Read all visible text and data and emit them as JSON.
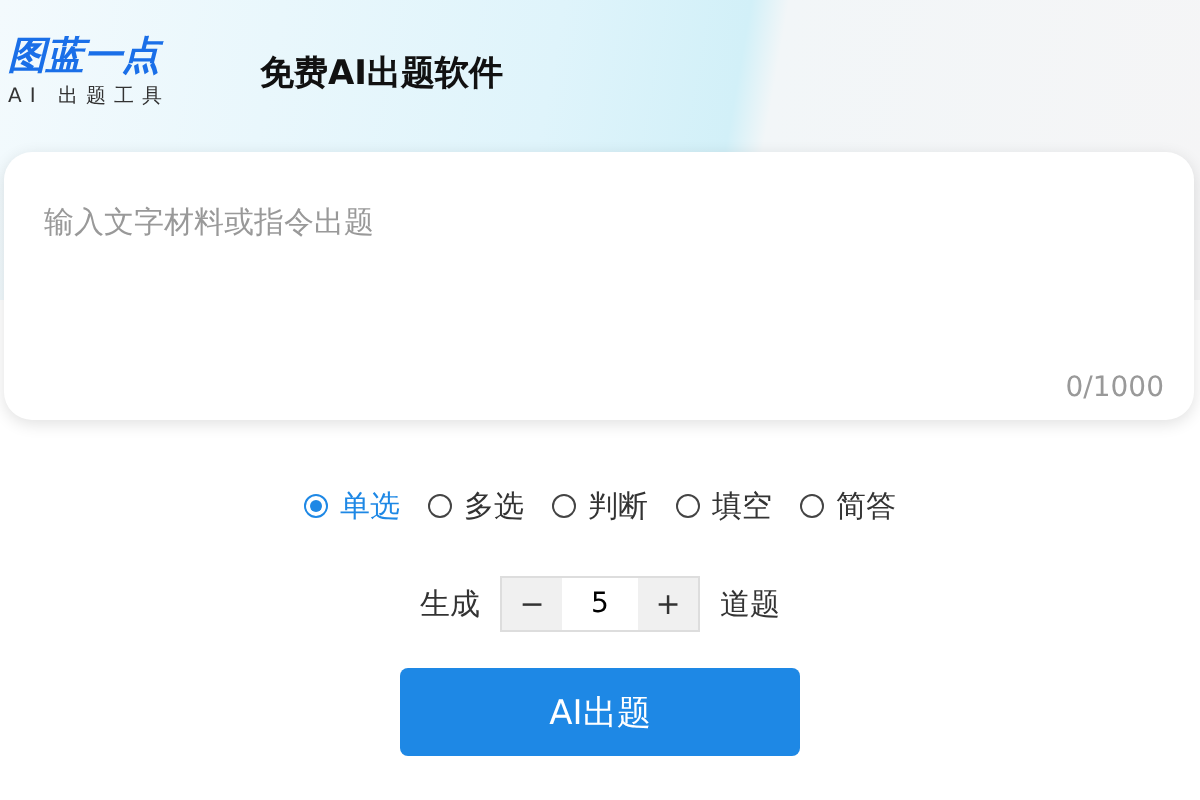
{
  "logo": {
    "name": "图蓝一点",
    "tagline": "AI 出题工具"
  },
  "header": {
    "title": "免费AI出题软件"
  },
  "input": {
    "placeholder": "输入文字材料或指令出题",
    "counter": "0/1000"
  },
  "question_types": [
    {
      "label": "单选",
      "selected": true
    },
    {
      "label": "多选",
      "selected": false
    },
    {
      "label": "判断",
      "selected": false
    },
    {
      "label": "填空",
      "selected": false
    },
    {
      "label": "简答",
      "selected": false
    }
  ],
  "count": {
    "prefix": "生成",
    "minus": "−",
    "value": "5",
    "plus": "+",
    "suffix": "道题"
  },
  "submit": {
    "label": "AI出题"
  }
}
